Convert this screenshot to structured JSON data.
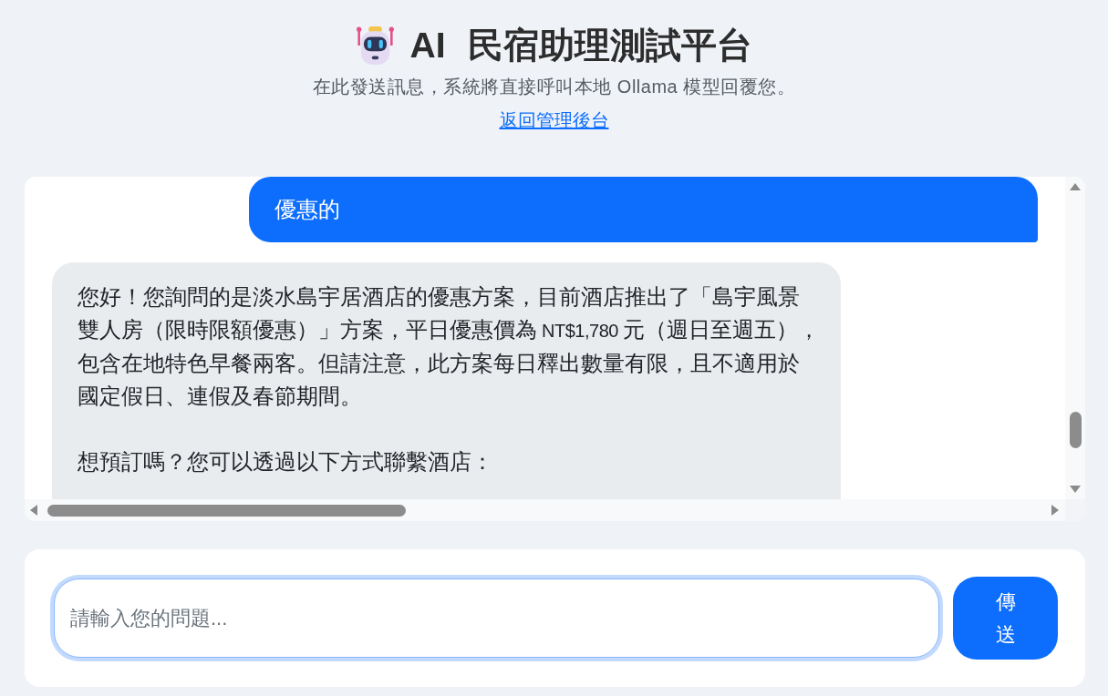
{
  "header": {
    "title": "AI 民宿助理測試平台",
    "subtitle": "在此發送訊息，系統將直接呼叫本地 Ollama 模型回覆您。",
    "back_link": "返回管理後台"
  },
  "chat": {
    "messages": [
      {
        "kind": "user",
        "text": "優惠的"
      },
      {
        "kind": "assistant",
        "paragraphs": [
          "您好！您詢問的是淡水島宇居酒店的優惠方案，目前酒店推出了「島宇風景雙人房（限時限額優惠）」方案，平日優惠價為 NT$1,780 元（週日至週五），包含在地特色早餐兩客。但請注意，此方案每日釋出數量有限，且不適用於國定假日、連假及春節期間。",
          "想預訂嗎？您可以透過以下方式聯繫酒店："
        ]
      }
    ]
  },
  "composer": {
    "placeholder": "請輸入您的問題...",
    "focused": true,
    "send_button": "傳送"
  }
}
